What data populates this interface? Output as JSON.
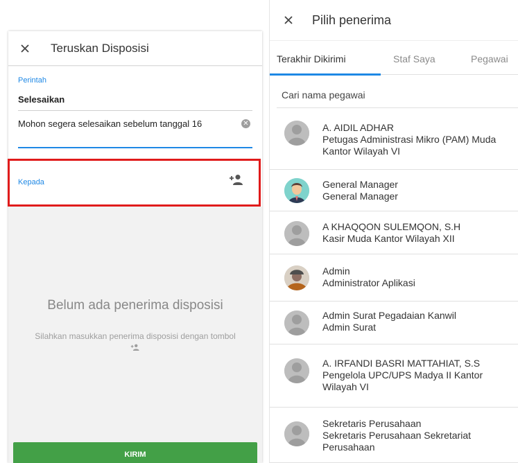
{
  "forward_dialog": {
    "title": "Teruskan Disposisi",
    "perintah_label": "Perintah",
    "perintah_value": "Selesaikan",
    "note_value": "Mohon segera selesaikan sebelum tanggal 16",
    "kepada_label": "Kepada",
    "empty_title": "Belum ada penerima disposisi",
    "empty_subtitle": "Silahkan masukkan penerima disposisi dengan tombol",
    "send_label": "KIRIM"
  },
  "recipient_picker": {
    "title": "Pilih penerima",
    "tabs": [
      {
        "label": "Terakhir Dikirimi",
        "active": true
      },
      {
        "label": "Staf Saya",
        "active": false
      },
      {
        "label": "Pegawai",
        "active": false
      }
    ],
    "search_placeholder": "Cari nama pegawai",
    "recipients": [
      {
        "name": "A. AIDIL ADHAR",
        "position": "Petugas Administrasi Mikro (PAM) Muda Kantor Wilayah VI",
        "avatar": "default-person"
      },
      {
        "name": "General Manager",
        "position": "General Manager",
        "avatar": "manager-cartoon"
      },
      {
        "name": "A KHAQQON SULEMQON, S.H",
        "position": "Kasir Muda Kantor Wilayah XII",
        "avatar": "default-person"
      },
      {
        "name": "Admin",
        "position": "Administrator Aplikasi",
        "avatar": "photo"
      },
      {
        "name": "Admin Surat Pegadaian Kanwil",
        "position": "Admin Surat",
        "avatar": "default-person"
      },
      {
        "name": "A. IRFANDI BASRI MATTAHIAT, S.S",
        "position": "Pengelola UPC/UPS Madya II Kantor Wilayah VI",
        "avatar": "default-person"
      },
      {
        "name": "Sekretaris Perusahaan",
        "position": "Sekretaris Perusahaan Sekretariat Perusahaan",
        "avatar": "default-person"
      }
    ]
  },
  "colors": {
    "accent": "#1e88e5",
    "send_button": "#43a047",
    "highlight": "#e01b1b"
  }
}
